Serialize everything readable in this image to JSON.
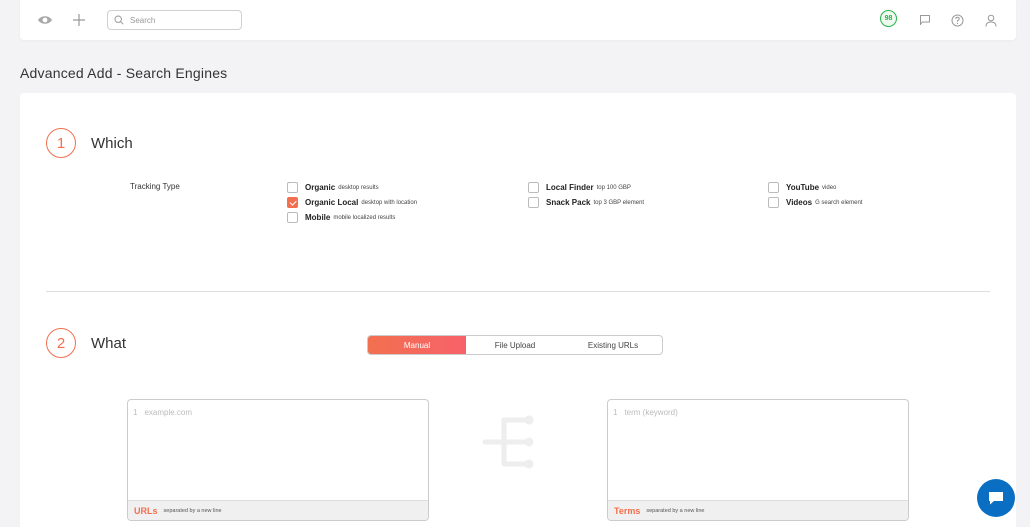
{
  "topbar": {
    "search_placeholder": "Search",
    "score": "98"
  },
  "page": {
    "title": "Advanced Add - Search Engines"
  },
  "step1": {
    "number": "1",
    "title": "Which",
    "tracking_label": "Tracking Type",
    "options": [
      {
        "name": "Organic",
        "desc": "desktop results",
        "checked": false
      },
      {
        "name": "Organic Local",
        "desc": "desktop with location",
        "checked": true
      },
      {
        "name": "Mobile",
        "desc": "mobile localized results",
        "checked": false
      },
      {
        "name": "Local Finder",
        "desc": "top 100 GBP",
        "checked": false
      },
      {
        "name": "Snack Pack",
        "desc": "top 3 GBP element",
        "checked": false
      },
      {
        "name": "YouTube",
        "desc": "video",
        "checked": false
      },
      {
        "name": "Videos",
        "desc": "G search element",
        "checked": false
      }
    ]
  },
  "step2": {
    "number": "2",
    "title": "What",
    "tabs": [
      {
        "label": "Manual",
        "active": true
      },
      {
        "label": "File Upload",
        "active": false
      },
      {
        "label": "Existing URLs",
        "active": false
      }
    ],
    "urls_box": {
      "line_no": "1",
      "placeholder": "example.com",
      "footer_name": "URLs",
      "footer_desc": "separated by a new line"
    },
    "terms_box": {
      "line_no": "1",
      "placeholder": "term (keyword)",
      "footer_name": "Terms",
      "footer_desc": "separated by a new line"
    }
  },
  "colors": {
    "accent": "#f2704f",
    "score_green": "#29b34a",
    "chat_blue": "#0a6fc2"
  }
}
